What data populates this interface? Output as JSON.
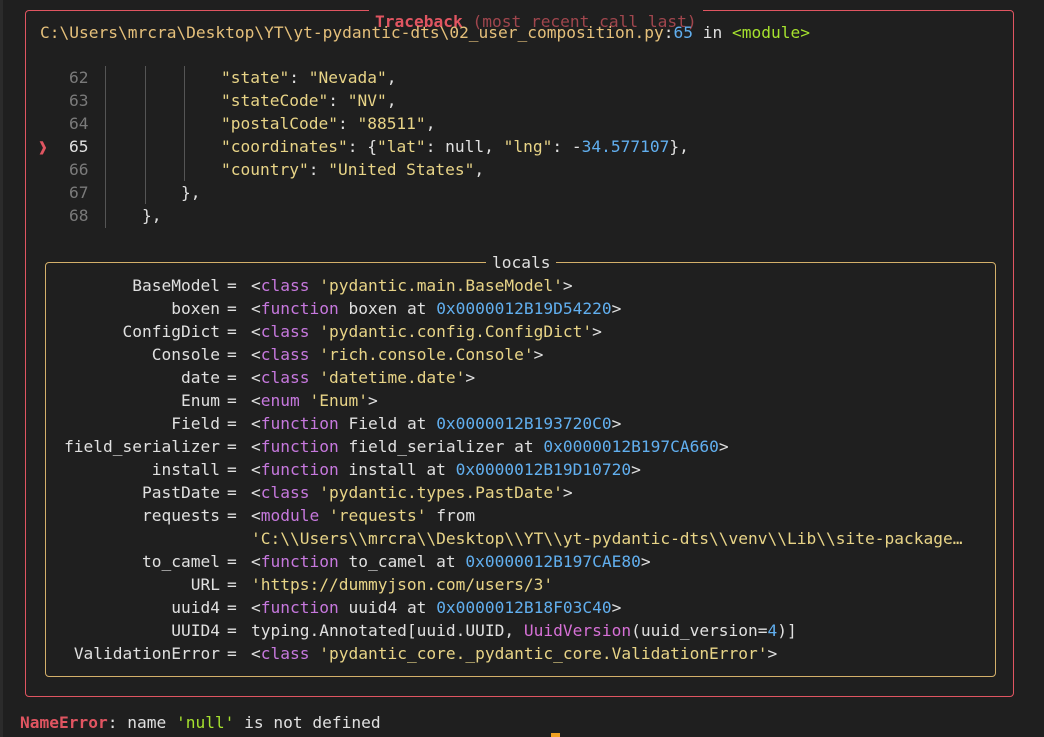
{
  "traceback": {
    "title": "Traceback",
    "subtitle": "(most recent call last)",
    "location_path": "C:\\Users\\mrcra\\Desktop\\YT\\yt-pydantic-dts\\02_user_composition.py",
    "location_sep": ":",
    "location_line": "65",
    "location_in": " in ",
    "location_func": "<module>",
    "marker": "❱"
  },
  "code_lines": [
    {
      "no": "62",
      "parts": [
        [
          "str",
          "\"state\""
        ],
        [
          "white",
          ": "
        ],
        [
          "str",
          "\"Nevada\""
        ],
        [
          "white",
          ","
        ]
      ]
    },
    {
      "no": "63",
      "parts": [
        [
          "str",
          "\"stateCode\""
        ],
        [
          "white",
          ": "
        ],
        [
          "str",
          "\"NV\""
        ],
        [
          "white",
          ","
        ]
      ]
    },
    {
      "no": "64",
      "parts": [
        [
          "str",
          "\"postalCode\""
        ],
        [
          "white",
          ": "
        ],
        [
          "str",
          "\"88511\""
        ],
        [
          "white",
          ","
        ]
      ]
    },
    {
      "no": "65",
      "parts": [
        [
          "str",
          "\"coordinates\""
        ],
        [
          "white",
          ": {"
        ],
        [
          "str",
          "\"lat\""
        ],
        [
          "white",
          ": null, "
        ],
        [
          "str",
          "\"lng\""
        ],
        [
          "white",
          ": -"
        ],
        [
          "blue",
          "34.577107"
        ],
        [
          "white",
          "},"
        ]
      ]
    },
    {
      "no": "66",
      "parts": [
        [
          "str",
          "\"country\""
        ],
        [
          "white",
          ": "
        ],
        [
          "str",
          "\"United States\""
        ],
        [
          "white",
          ","
        ]
      ]
    },
    {
      "no": "67",
      "parts": [
        [
          "white",
          "},"
        ]
      ]
    },
    {
      "no": "68",
      "parts": [
        [
          "white",
          "},"
        ]
      ]
    }
  ],
  "locals": {
    "title": "locals",
    "rows": [
      {
        "key": "BaseModel",
        "parts": [
          [
            "white",
            "<"
          ],
          [
            "purple",
            "class"
          ],
          [
            "white",
            " "
          ],
          [
            "str",
            "'pydantic.main.BaseModel'"
          ],
          [
            "white",
            ">"
          ]
        ]
      },
      {
        "key": "boxen",
        "parts": [
          [
            "white",
            "<"
          ],
          [
            "purple",
            "function"
          ],
          [
            "white",
            " boxen at "
          ],
          [
            "blue",
            "0x0000012B19D54220"
          ],
          [
            "white",
            ">"
          ]
        ]
      },
      {
        "key": "ConfigDict",
        "parts": [
          [
            "white",
            "<"
          ],
          [
            "purple",
            "class"
          ],
          [
            "white",
            " "
          ],
          [
            "str",
            "'pydantic.config.ConfigDict'"
          ],
          [
            "white",
            ">"
          ]
        ]
      },
      {
        "key": "Console",
        "parts": [
          [
            "white",
            "<"
          ],
          [
            "purple",
            "class"
          ],
          [
            "white",
            " "
          ],
          [
            "str",
            "'rich.console.Console'"
          ],
          [
            "white",
            ">"
          ]
        ]
      },
      {
        "key": "date",
        "parts": [
          [
            "white",
            "<"
          ],
          [
            "purple",
            "class"
          ],
          [
            "white",
            " "
          ],
          [
            "str",
            "'datetime.date'"
          ],
          [
            "white",
            ">"
          ]
        ]
      },
      {
        "key": "Enum",
        "parts": [
          [
            "white",
            "<"
          ],
          [
            "purple",
            "enum"
          ],
          [
            "white",
            " "
          ],
          [
            "str",
            "'Enum'"
          ],
          [
            "white",
            ">"
          ]
        ]
      },
      {
        "key": "Field",
        "parts": [
          [
            "white",
            "<"
          ],
          [
            "purple",
            "function"
          ],
          [
            "white",
            " Field at "
          ],
          [
            "blue",
            "0x0000012B193720C0"
          ],
          [
            "white",
            ">"
          ]
        ]
      },
      {
        "key": "field_serializer",
        "parts": [
          [
            "white",
            "<"
          ],
          [
            "purple",
            "function"
          ],
          [
            "white",
            " field_serializer at "
          ],
          [
            "blue",
            "0x0000012B197CA660"
          ],
          [
            "white",
            ">"
          ]
        ]
      },
      {
        "key": "install",
        "parts": [
          [
            "white",
            "<"
          ],
          [
            "purple",
            "function"
          ],
          [
            "white",
            " install at "
          ],
          [
            "blue",
            "0x0000012B19D10720"
          ],
          [
            "white",
            ">"
          ]
        ]
      },
      {
        "key": "PastDate",
        "parts": [
          [
            "white",
            "<"
          ],
          [
            "purple",
            "class"
          ],
          [
            "white",
            " "
          ],
          [
            "str",
            "'pydantic.types.PastDate'"
          ],
          [
            "white",
            ">"
          ]
        ]
      },
      {
        "key": "requests",
        "parts": [
          [
            "white",
            "<"
          ],
          [
            "purple",
            "module"
          ],
          [
            "white",
            " "
          ],
          [
            "str",
            "'requests'"
          ],
          [
            "white",
            " from"
          ]
        ]
      },
      {
        "key": "",
        "parts": [
          [
            "str",
            "'C:\\\\Users\\\\mrcra\\\\Desktop\\\\YT\\\\yt-pydantic-dts\\\\venv\\\\Lib\\\\site-package…"
          ]
        ]
      },
      {
        "key": "to_camel",
        "parts": [
          [
            "white",
            "<"
          ],
          [
            "purple",
            "function"
          ],
          [
            "white",
            " to_camel at "
          ],
          [
            "blue",
            "0x0000012B197CAE80"
          ],
          [
            "white",
            ">"
          ]
        ]
      },
      {
        "key": "URL",
        "parts": [
          [
            "str",
            "'https://dummyjson.com/users/3'"
          ]
        ]
      },
      {
        "key": "uuid4",
        "parts": [
          [
            "white",
            "<"
          ],
          [
            "purple",
            "function"
          ],
          [
            "white",
            " uuid4 at "
          ],
          [
            "blue",
            "0x0000012B18F03C40"
          ],
          [
            "white",
            ">"
          ]
        ]
      },
      {
        "key": "UUID4",
        "parts": [
          [
            "white",
            "typing.Annotated[uuid.UUID, "
          ],
          [
            "magenta",
            "UuidVersion"
          ],
          [
            "white",
            "(uuid_version="
          ],
          [
            "blue",
            "4"
          ],
          [
            "white",
            ")]"
          ]
        ]
      },
      {
        "key": "ValidationError",
        "parts": [
          [
            "white",
            "<"
          ],
          [
            "purple",
            "class"
          ],
          [
            "white",
            " "
          ],
          [
            "str",
            "'pydantic_core._pydantic_core.ValidationError'"
          ],
          [
            "white",
            ">"
          ]
        ]
      }
    ]
  },
  "error": {
    "type": "NameError",
    "colon": ": ",
    "msg_before": "name ",
    "msg_quoted": "'null'",
    "msg_after": " is not defined"
  }
}
